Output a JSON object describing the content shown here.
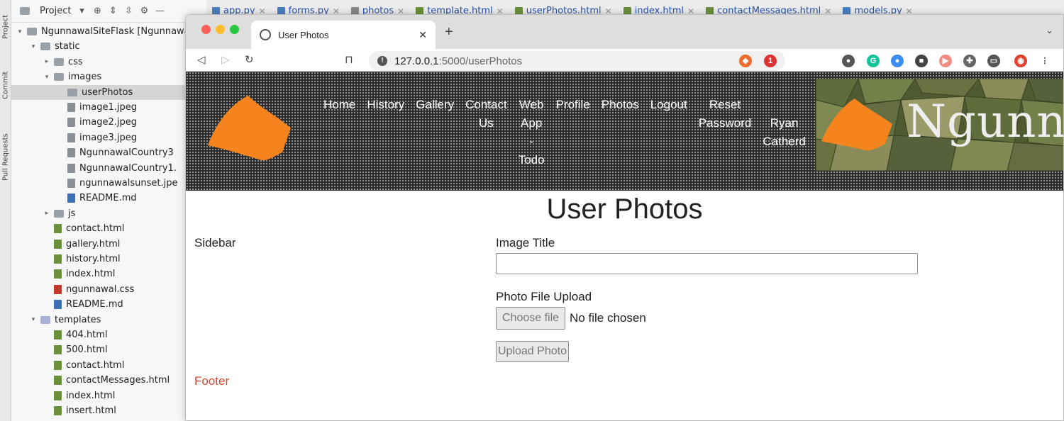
{
  "ide": {
    "strip_tabs": [
      "Project",
      "Commit",
      "Pull Requests"
    ],
    "header": {
      "title": "Project"
    },
    "tree": [
      {
        "label": "NgunnawalSiteFlask [Ngunnawal",
        "kind": "folder",
        "indent": 0,
        "open": true
      },
      {
        "label": "static",
        "kind": "folder",
        "indent": 1,
        "open": true
      },
      {
        "label": "css",
        "kind": "folder",
        "indent": 2,
        "open": false
      },
      {
        "label": "images",
        "kind": "folder",
        "indent": 2,
        "open": true
      },
      {
        "label": "userPhotos",
        "kind": "folder",
        "indent": 3,
        "selected": true
      },
      {
        "label": "image1.jpeg",
        "kind": "img",
        "indent": 3
      },
      {
        "label": "image2.jpeg",
        "kind": "img",
        "indent": 3
      },
      {
        "label": "image3.jpeg",
        "kind": "img",
        "indent": 3
      },
      {
        "label": "NgunnawalCountry3",
        "kind": "img",
        "indent": 3
      },
      {
        "label": "NgunnawalCountry1.",
        "kind": "img",
        "indent": 3
      },
      {
        "label": "ngunnawalsunset.jpe",
        "kind": "img",
        "indent": 3
      },
      {
        "label": "README.md",
        "kind": "md",
        "indent": 3
      },
      {
        "label": "js",
        "kind": "folder",
        "indent": 2,
        "open": false
      },
      {
        "label": "contact.html",
        "kind": "h",
        "indent": 2
      },
      {
        "label": "gallery.html",
        "kind": "h",
        "indent": 2
      },
      {
        "label": "history.html",
        "kind": "h",
        "indent": 2
      },
      {
        "label": "index.html",
        "kind": "h",
        "indent": 2
      },
      {
        "label": "ngunnawal.css",
        "kind": "css",
        "indent": 2
      },
      {
        "label": "README.md",
        "kind": "md",
        "indent": 2
      },
      {
        "label": "templates",
        "kind": "tplfolder",
        "indent": 1,
        "open": true
      },
      {
        "label": "404.html",
        "kind": "h",
        "indent": 2
      },
      {
        "label": "500.html",
        "kind": "h",
        "indent": 2
      },
      {
        "label": "contact.html",
        "kind": "h",
        "indent": 2
      },
      {
        "label": "contactMessages.html",
        "kind": "h",
        "indent": 2
      },
      {
        "label": "index.html",
        "kind": "h",
        "indent": 2
      },
      {
        "label": "insert.html",
        "kind": "h",
        "indent": 2
      }
    ],
    "editor_tabs": [
      {
        "label": "app.py",
        "kind": "py"
      },
      {
        "label": "forms.py",
        "kind": "py"
      },
      {
        "label": "photos",
        "kind": "table"
      },
      {
        "label": "template.html",
        "kind": "h"
      },
      {
        "label": "userPhotos.html",
        "kind": "h"
      },
      {
        "label": "index.html",
        "kind": "h"
      },
      {
        "label": "contactMessages.html",
        "kind": "h"
      },
      {
        "label": "models.py",
        "kind": "py"
      }
    ]
  },
  "browser": {
    "tab_title": "User Photos",
    "url_host": "127.0.0.1",
    "url_path": ":5000/userPhotos",
    "brave_badge": "1"
  },
  "site": {
    "nav": [
      [
        "Home"
      ],
      [
        "History"
      ],
      [
        "Gallery"
      ],
      [
        "Contact",
        "Us"
      ],
      [
        "Web",
        "App",
        "-",
        "Todo"
      ],
      [
        "Profile"
      ],
      [
        "Photos"
      ],
      [
        "Logout"
      ],
      [
        "Reset",
        "Password"
      ],
      [
        "",
        "Ryan",
        "Catherd"
      ]
    ],
    "banner_text": "Ngunna",
    "page_title": "User Photos",
    "sidebar": "Sidebar",
    "form": {
      "title_label": "Image Title",
      "title_value": "",
      "file_label": "Photo File Upload",
      "choose_button": "Choose file",
      "no_file": "No file chosen",
      "submit_button": "Upload Photo"
    },
    "footer": "Footer",
    "colors": {
      "logo_orange": "#f5841f",
      "footer_red": "#d9452b"
    }
  }
}
